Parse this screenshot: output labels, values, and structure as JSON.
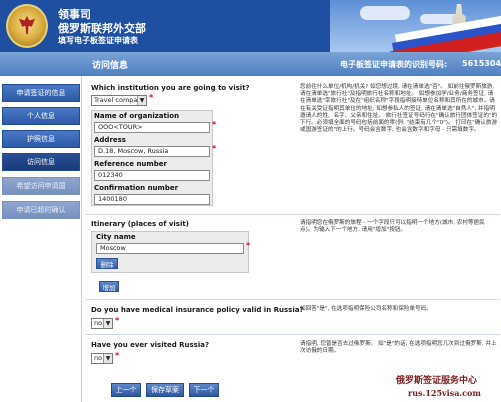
{
  "header": {
    "line1": "领事司",
    "line2": "俄罗斯联邦外交部",
    "line3": "填写电子板签证申请表"
  },
  "titlebar": {
    "section": "访问信息",
    "id_label": "电子板签证申请表的识别号码:",
    "id_value": "5615304"
  },
  "sidebar": {
    "items": [
      {
        "label": "申请签证的信息"
      },
      {
        "label": "个人信息"
      },
      {
        "label": "护照信息"
      },
      {
        "label": "访问信息"
      },
      {
        "label": "希望访问申请国"
      },
      {
        "label": "申请已超时确认"
      }
    ]
  },
  "q_institution": {
    "label": "Which institution you are going to visit?",
    "value": "Travel company",
    "fields": {
      "org_label": "Name of organization",
      "org_value": "OOO<TOUR>",
      "address_label": "Address",
      "address_value": "D.18, Moscow, Russia",
      "ref_label": "Reference number",
      "ref_value": "012340",
      "conf_label": "Confirmation number",
      "conf_value": "1400180"
    },
    "help": "您前往什么单位/机构/机关? 如您想过境, 请在清单选\"否\"。 如前往俄罗斯旅游, 请在清单选\"旅行社\"及指明旅行社名称和地址。 如想参加学/业务/商务签证, 请在清单选\"宰旅行社\"及在\"组织名称\"字段指明接待单位名称和其所在的城市。请在有关受证指明其单位的地址, 如想参私人的签证, 请在清单选\"自然人\", 并指明邀请人的姓、名字、父亲和住址。 旅行社签证号码行在\"确认旅行团体签证的\"的下行。必须填全面的号码包括前面的零(例: \"结束有几个\"0\")。 打印在\"确认旅游或国游签证的\"的上行。号码会含数字, 也会含数字和字母 - 只需填数字。"
  },
  "q_itinerary": {
    "label": "Itinerary (places of visit)",
    "city_label": "City name",
    "city_value": "Moscow",
    "delete_button": "删除",
    "add_button": "增加",
    "help": "请指明您在俄罗斯的旅程 - 一个字段只可以指明一个地方(城市, 农村等居民点)。为输入下一个地方, 请用\"增加\"按钮。"
  },
  "q_insurance": {
    "label": "Do you have medical insurance policy valid in Russia?",
    "value": "no",
    "help": "如回答\"是\", 在选项指明保险公司名称和保险单号码。"
  },
  "q_visited": {
    "label": "Have you ever visited Russia?",
    "value": "no",
    "help": "请指明, 您曾是否去过俄罗斯。 如\"是\"的话, 在选项指明您几次到过俄罗斯, 并上次访俄的日期。"
  },
  "footer": {
    "prev": "上一个",
    "save": "保存草案",
    "next": "下一个"
  },
  "watermark": {
    "line1": "俄罗斯签证服务中心",
    "line2": "rus.125visa.com"
  }
}
